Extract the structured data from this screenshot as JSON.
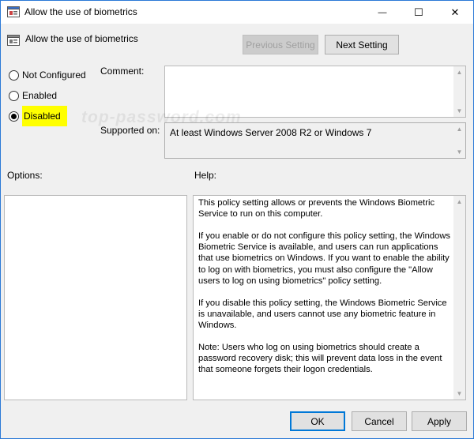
{
  "window": {
    "title": "Allow the use of biometrics",
    "minimize_glyph": "—",
    "maximize_glyph": "☐",
    "close_glyph": "✕"
  },
  "header": {
    "policy_title": "Allow the use of biometrics",
    "previous_setting": "Previous Setting",
    "next_setting": "Next Setting"
  },
  "state": {
    "options": [
      {
        "label": "Not Configured",
        "checked": false
      },
      {
        "label": "Enabled",
        "checked": false
      },
      {
        "label": "Disabled",
        "checked": true
      }
    ]
  },
  "comment": {
    "label": "Comment:",
    "value": ""
  },
  "supported": {
    "label": "Supported on:",
    "value": "At least Windows Server 2008 R2 or Windows 7"
  },
  "watermark": "top-password.com",
  "options_label": "Options:",
  "help_label": "Help:",
  "help_paragraphs": [
    "This policy setting allows or prevents the Windows Biometric Service to run on this computer.",
    "If you enable or do not configure this policy setting, the Windows Biometric Service is available, and users can run applications that use biometrics on Windows. If you want to enable the ability to log on with biometrics, you must also configure the \"Allow users to log on using biometrics\" policy setting.",
    "If you disable this policy setting, the Windows Biometric Service is unavailable, and users cannot use any biometric feature in Windows.",
    "Note: Users who log on using biometrics should create a password recovery disk; this will prevent data loss in the event that someone forgets their logon credentials."
  ],
  "footer": {
    "ok": "OK",
    "cancel": "Cancel",
    "apply": "Apply"
  },
  "colors": {
    "accent": "#0078d7",
    "highlight": "#ffff00",
    "frame": "#2b79d7"
  }
}
